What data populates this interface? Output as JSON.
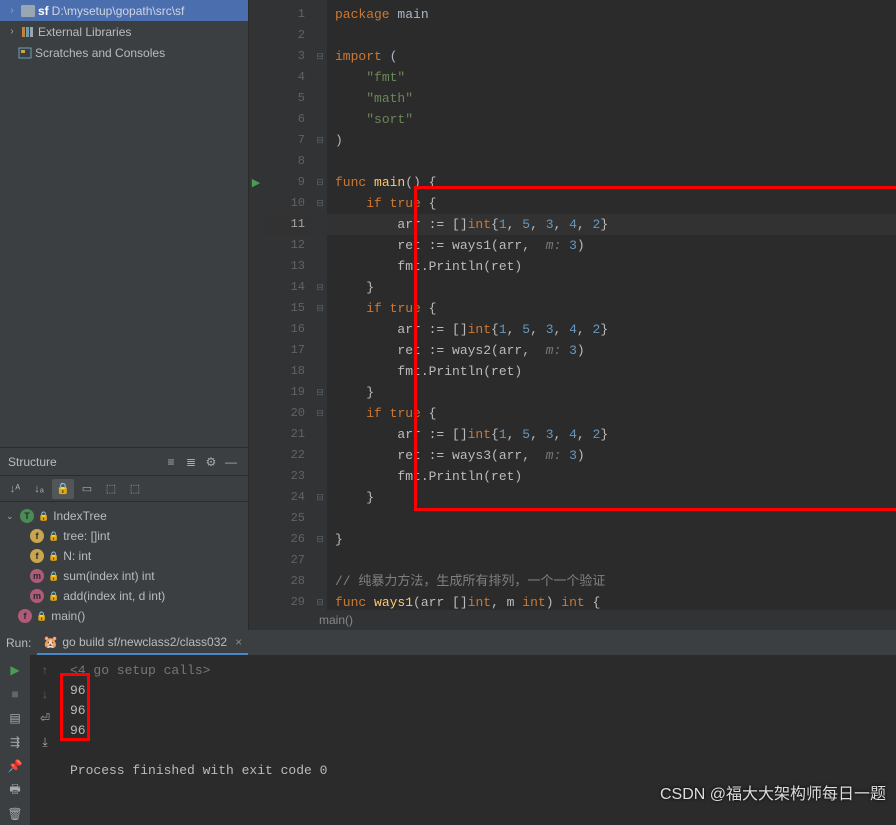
{
  "project": {
    "root_name": "sf",
    "root_path": "D:\\mysetup\\gopath\\src\\sf",
    "external_libs": "External Libraries",
    "scratches": "Scratches and Consoles"
  },
  "structure": {
    "title": "Structure",
    "root": "IndexTree",
    "members": [
      {
        "icon": "f",
        "lock": true,
        "label": "tree: []int"
      },
      {
        "icon": "f",
        "lock": true,
        "label": "N: int"
      },
      {
        "icon": "m",
        "lock": true,
        "label": "sum(index int) int"
      },
      {
        "icon": "m",
        "lock": true,
        "label": "add(index int, d int)"
      }
    ],
    "main_fn": "main()"
  },
  "editor": {
    "current_line": 11,
    "run_marker_line": 9,
    "lines": [
      {
        "n": 1,
        "html": "<span class='kw'>package</span> <span class='ident'>main</span>"
      },
      {
        "n": 2,
        "html": ""
      },
      {
        "n": 3,
        "html": "<span class='kw'>import</span> <span class='ident'>(</span>"
      },
      {
        "n": 4,
        "html": "    <span class='str'>\"fmt\"</span>"
      },
      {
        "n": 5,
        "html": "    <span class='str'>\"math\"</span>"
      },
      {
        "n": 6,
        "html": "    <span class='str'>\"sort\"</span>"
      },
      {
        "n": 7,
        "html": "<span class='ident'>)</span>"
      },
      {
        "n": 8,
        "html": ""
      },
      {
        "n": 9,
        "html": "<span class='kw'>func</span> <span class='fn'>main</span>() {"
      },
      {
        "n": 10,
        "html": "    <span class='kw'>if</span> <span class='kw'>true</span> {"
      },
      {
        "n": 11,
        "html": "        arr := []<span class='kw'>int</span>{<span class='num'>1</span>, <span class='num'>5</span>, <span class='num'>3</span>, <span class='num'>4</span>, <span class='num'>2</span>}"
      },
      {
        "n": 12,
        "html": "        ret := ways1(arr,  <span class='hint'>m:</span> <span class='num'>3</span>)"
      },
      {
        "n": 13,
        "html": "        fmt.Println(ret)"
      },
      {
        "n": 14,
        "html": "    }"
      },
      {
        "n": 15,
        "html": "    <span class='kw'>if</span> <span class='kw'>true</span> {"
      },
      {
        "n": 16,
        "html": "        arr := []<span class='kw'>int</span>{<span class='num'>1</span>, <span class='num'>5</span>, <span class='num'>3</span>, <span class='num'>4</span>, <span class='num'>2</span>}"
      },
      {
        "n": 17,
        "html": "        ret := ways2(arr,  <span class='hint'>m:</span> <span class='num'>3</span>)"
      },
      {
        "n": 18,
        "html": "        fmt.Println(ret)"
      },
      {
        "n": 19,
        "html": "    }"
      },
      {
        "n": 20,
        "html": "    <span class='kw'>if</span> <span class='kw'>true</span> {"
      },
      {
        "n": 21,
        "html": "        arr := []<span class='kw'>int</span>{<span class='num'>1</span>, <span class='num'>5</span>, <span class='num'>3</span>, <span class='num'>4</span>, <span class='num'>2</span>}"
      },
      {
        "n": 22,
        "html": "        ret := ways3(arr,  <span class='hint'>m:</span> <span class='num'>3</span>)"
      },
      {
        "n": 23,
        "html": "        fmt.Println(ret)"
      },
      {
        "n": 24,
        "html": "    }"
      },
      {
        "n": 25,
        "html": ""
      },
      {
        "n": 26,
        "html": "}"
      },
      {
        "n": 27,
        "html": ""
      },
      {
        "n": 28,
        "html": "<span class='cm'>// 纯暴力方法，生成所有排列，一个一个验证</span>"
      },
      {
        "n": 29,
        "html": "<span class='kw'>func</span> <span class='fn'>ways1</span>(arr []<span class='kw'>int</span>, m <span class='kw'>int</span>) <span class='kw'>int</span> {"
      }
    ],
    "fold_markers": {
      "3": "⊟",
      "7": "⊟",
      "9": "⊟",
      "10": "⊟",
      "14": "⊟",
      "15": "⊟",
      "19": "⊟",
      "20": "⊟",
      "24": "⊟",
      "26": "⊟",
      "29": "⊟"
    },
    "breadcrumb": "main()"
  },
  "run": {
    "label": "Run:",
    "config": "go build sf/newclass2/class032",
    "output": [
      {
        "text": "<4 go setup calls>",
        "dim": true
      },
      {
        "text": "96"
      },
      {
        "text": "96"
      },
      {
        "text": "96"
      },
      {
        "text": ""
      },
      {
        "text": "Process finished with exit code 0"
      }
    ]
  },
  "watermark": "CSDN @福大大架构师每日一题"
}
